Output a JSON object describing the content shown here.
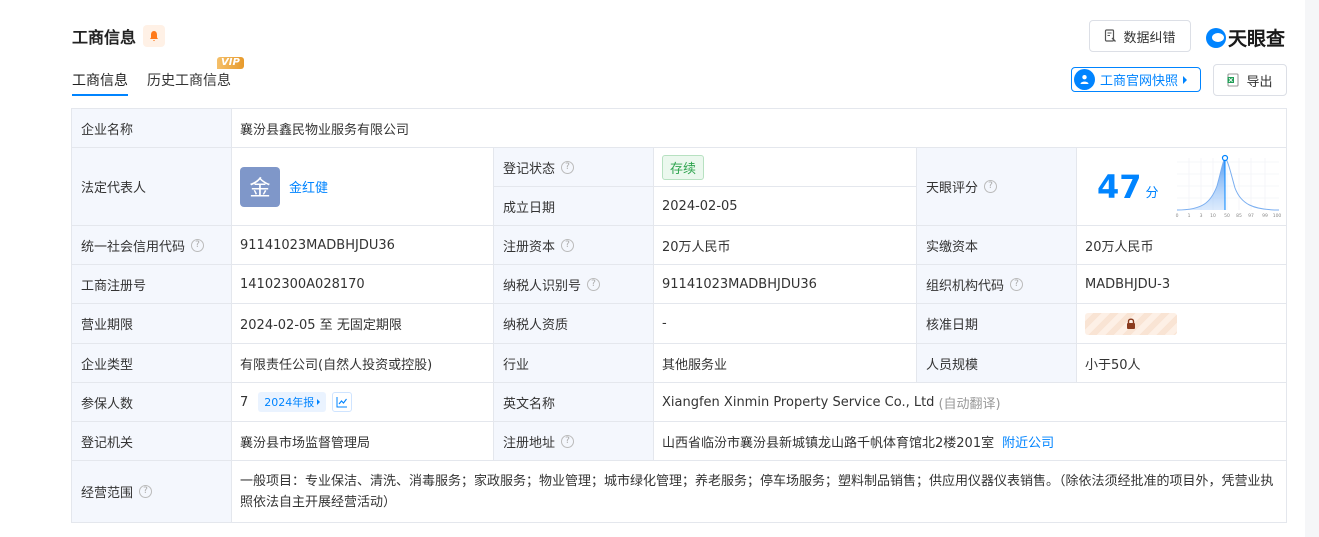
{
  "header": {
    "title": "工商信息",
    "tabs": [
      {
        "label": "工商信息"
      },
      {
        "label": "历史工商信息"
      }
    ],
    "vip_badge": "VIP",
    "fix_button": "数据纠错",
    "logo_text": "天眼查",
    "snapshot_button": "工商官网快照",
    "export_button": "导出"
  },
  "colors": {
    "accent": "#0084ff",
    "label_bg": "#f4f7fd",
    "status_green": "#2fa44f"
  },
  "icons": [
    "bell-icon",
    "document-edit-icon",
    "tianyancha-logo-icon",
    "snapshot-icon",
    "excel-icon",
    "help-icon",
    "trend-chart-icon",
    "lock-icon"
  ],
  "info": {
    "company_name_label": "企业名称",
    "company_name": "襄汾县鑫民物业服务有限公司",
    "legal_rep_label": "法定代表人",
    "legal_rep_avatar": "金",
    "legal_rep": "金红健",
    "reg_status_label": "登记状态",
    "reg_status": "存续",
    "established_label": "成立日期",
    "established": "2024-02-05",
    "score_label": "天眼评分",
    "score": "47",
    "score_unit": "分",
    "score_axis": [
      "0",
      "1",
      "3",
      "10",
      "50",
      "85",
      "97",
      "99",
      "100"
    ],
    "credit_code_label": "统一社会信用代码",
    "credit_code": "91141023MADBHJDU36",
    "reg_capital_label": "注册资本",
    "reg_capital": "20万人民币",
    "paid_capital_label": "实缴资本",
    "paid_capital": "20万人民币",
    "reg_no_label": "工商注册号",
    "reg_no": "14102300A028170",
    "taxpayer_id_label": "纳税人识别号",
    "taxpayer_id": "91141023MADBHJDU36",
    "org_code_label": "组织机构代码",
    "org_code": "MADBHJDU-3",
    "term_label": "营业期限",
    "term": "2024-02-05 至 无固定期限",
    "taxpayer_qual_label": "纳税人资质",
    "taxpayer_qual": "-",
    "approval_date_label": "核准日期",
    "company_type_label": "企业类型",
    "company_type": "有限责任公司(自然人投资或控股)",
    "industry_label": "行业",
    "industry": "其他服务业",
    "staff_size_label": "人员规模",
    "staff_size": "小于50人",
    "insured_label": "参保人数",
    "insured": "7",
    "insured_year": "2024年报",
    "english_name_label": "英文名称",
    "english_name": "Xiangfen Xinmin Property Service Co., Ltd",
    "english_note": "(自动翻译)",
    "authority_label": "登记机关",
    "authority": "襄汾县市场监督管理局",
    "address_label": "注册地址",
    "address": "山西省临汾市襄汾县新城镇龙山路千帆体育馆北2楼201室",
    "nearby_link": "附近公司",
    "scope_label": "经营范围",
    "scope": "一般项目：专业保洁、清洗、消毒服务；家政服务；物业管理；城市绿化管理；养老服务；停车场服务；塑料制品销售；供应用仪器仪表销售。（除依法须经批准的项目外，凭营业执照依法自主开展经营活动）"
  }
}
